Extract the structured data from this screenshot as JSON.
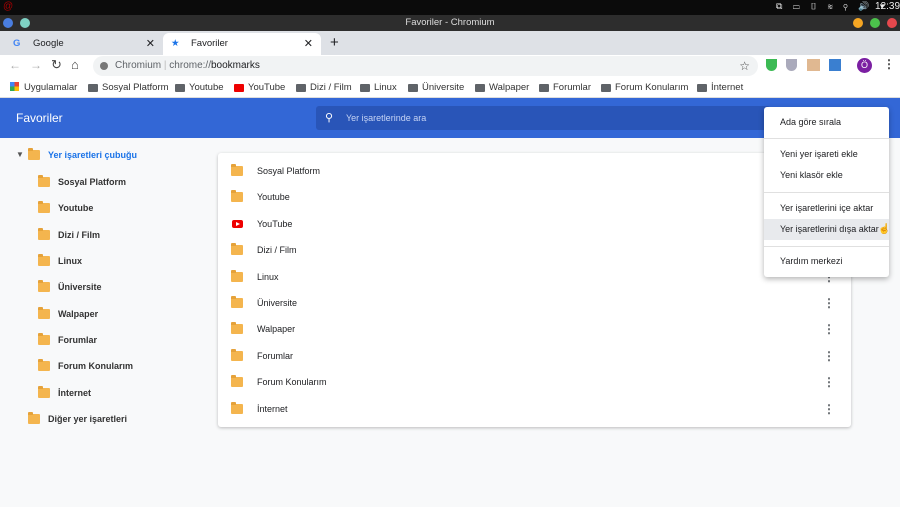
{
  "system": {
    "clock": "12:39"
  },
  "window": {
    "title": "Favoriler - Chromium"
  },
  "tabs": [
    {
      "label": "Google",
      "icon": "google-icon"
    },
    {
      "label": "Favoriler",
      "icon": "star-icon",
      "active": true
    }
  ],
  "toolbar": {
    "omnibox_site": "Chromium",
    "omnibox_url_prefix": "chrome://",
    "omnibox_url_host": "bookmarks",
    "profile_initial": "Ö"
  },
  "bookmarks_bar": [
    {
      "label": "Uygulamalar",
      "icon": "apps-grid-icon"
    },
    {
      "label": "Sosyal Platform",
      "icon": "folder-icon"
    },
    {
      "label": "Youtube",
      "icon": "folder-icon"
    },
    {
      "label": "YouTube",
      "icon": "youtube-icon"
    },
    {
      "label": "Dizi / Film",
      "icon": "folder-icon"
    },
    {
      "label": "Linux",
      "icon": "folder-icon"
    },
    {
      "label": "Üniversite",
      "icon": "folder-icon"
    },
    {
      "label": "Walpaper",
      "icon": "folder-icon"
    },
    {
      "label": "Forumlar",
      "icon": "folder-icon"
    },
    {
      "label": "Forum Konularım",
      "icon": "folder-icon"
    },
    {
      "label": "İnternet",
      "icon": "folder-icon"
    }
  ],
  "header": {
    "title": "Favoriler",
    "search_placeholder": "Yer işaretlerinde ara"
  },
  "sidebar": {
    "root": "Yer işaretleri çubuğu",
    "items": [
      "Sosyal Platform",
      "Youtube",
      "Dizi / Film",
      "Linux",
      "Üniversite",
      "Walpaper",
      "Forumlar",
      "Forum Konularım",
      "İnternet"
    ],
    "other": "Diğer yer işaretleri"
  },
  "list": [
    {
      "label": "Sosyal Platform",
      "type": "folder"
    },
    {
      "label": "Youtube",
      "type": "folder"
    },
    {
      "label": "YouTube",
      "type": "youtube"
    },
    {
      "label": "Dizi / Film",
      "type": "folder"
    },
    {
      "label": "Linux",
      "type": "folder"
    },
    {
      "label": "Üniversite",
      "type": "folder"
    },
    {
      "label": "Walpaper",
      "type": "folder"
    },
    {
      "label": "Forumlar",
      "type": "folder"
    },
    {
      "label": "Forum Konularım",
      "type": "folder"
    },
    {
      "label": "İnternet",
      "type": "folder"
    }
  ],
  "menu": [
    "Ada göre sırala",
    "Yeni yer işareti ekle",
    "Yeni klasör ekle",
    "Yer işaretlerini içe aktar",
    "Yer işaretlerini dışa aktar",
    "Yardım merkezi"
  ],
  "colors": {
    "header": "#3367d6",
    "folder": "#f4b54e",
    "accent": "#1a73e8"
  }
}
